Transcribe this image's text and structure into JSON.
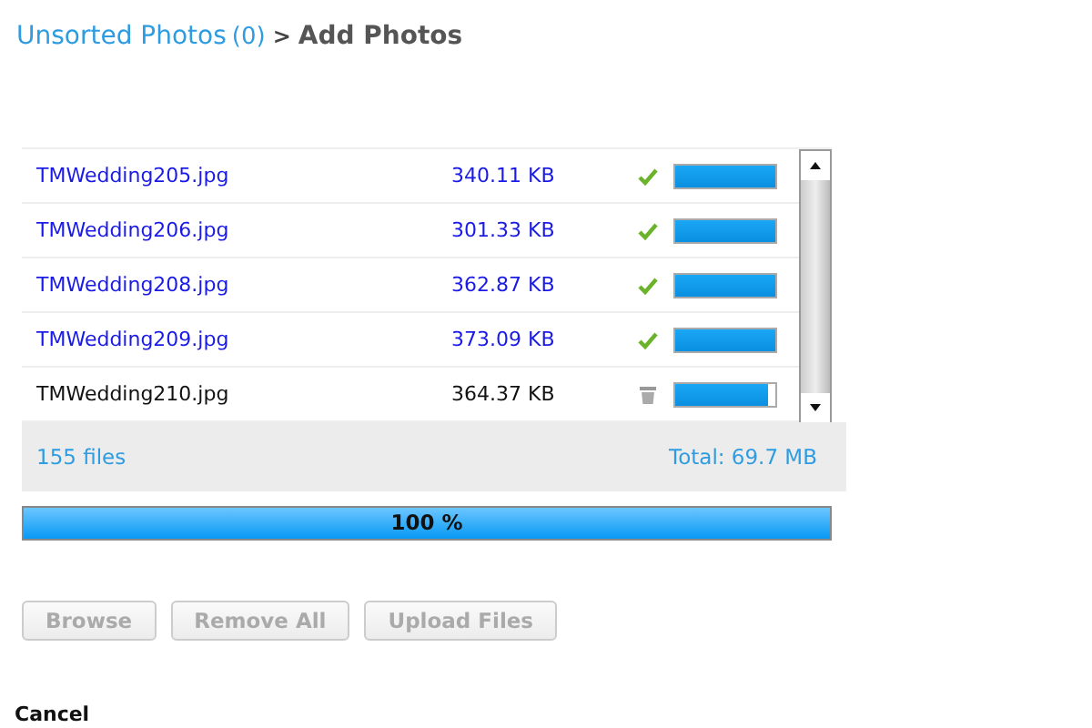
{
  "breadcrumb": {
    "link": "Unsorted Photos",
    "count": "(0)",
    "separator": ">",
    "current": "Add Photos"
  },
  "files": [
    {
      "name": "TMWedding205.jpg",
      "size": "340.11 KB",
      "kind": "done",
      "level": 1
    },
    {
      "name": "TMWedding206.jpg",
      "size": "301.33 KB",
      "kind": "done",
      "level": 1
    },
    {
      "name": "TMWedding208.jpg",
      "size": "362.87 KB",
      "kind": "done",
      "level": 1
    },
    {
      "name": "TMWedding209.jpg",
      "size": "373.09 KB",
      "kind": "done",
      "level": 1
    },
    {
      "name": "TMWedding210.jpg",
      "size": "364.37 KB",
      "kind": "uploading",
      "level": 0.93
    }
  ],
  "summary": {
    "count": "155 files",
    "total": "Total: 69.7 MB"
  },
  "progress": {
    "label": "100 %",
    "level": 1
  },
  "buttons": [
    {
      "label": "Browse",
      "disabled": true
    },
    {
      "label": "Remove All",
      "disabled": true
    },
    {
      "label": "Upload Files",
      "disabled": true
    }
  ],
  "cancel": "Cancel"
}
